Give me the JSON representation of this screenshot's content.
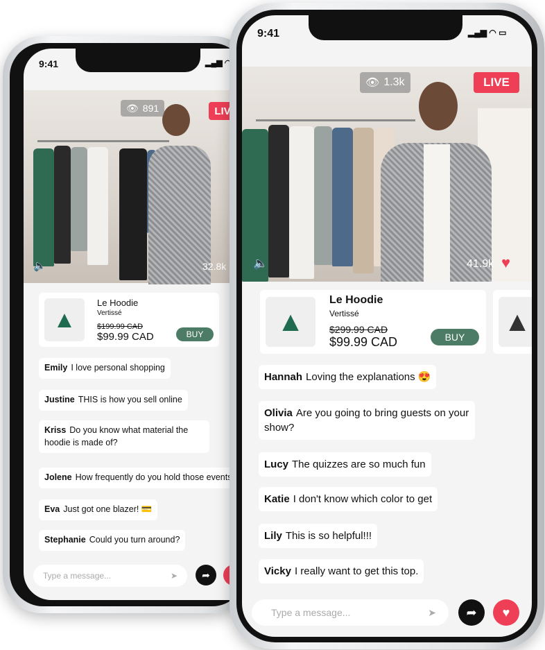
{
  "left_phone": {
    "time": "9:41",
    "viewers": "891",
    "live": "LIVE",
    "likes": "32.8k",
    "product": {
      "name": "Le Hoodie",
      "brand": "Vertissé",
      "old_price": "$199.99 CAD",
      "price": "$99.99 CAD",
      "buy": "BUY"
    },
    "chat": [
      {
        "user": "Emily",
        "text": "I love personal shopping"
      },
      {
        "user": "Justine",
        "text": "THIS is how you sell online"
      },
      {
        "user": "Kriss",
        "text": "Do you know what material the hoodie is made of?"
      },
      {
        "user": "Jolene",
        "text": "How frequently do you hold those events?"
      },
      {
        "user": "Eva",
        "text": "Just got one blazer! 💳"
      },
      {
        "user": "Stephanie",
        "text": "Could you turn around?"
      }
    ],
    "input_placeholder": "Type a message..."
  },
  "right_phone": {
    "time": "9:41",
    "viewers": "1.3k",
    "live": "LIVE",
    "likes": "41.9k",
    "product": {
      "name": "Le Hoodie",
      "brand": "Vertissé",
      "old_price": "$299.99 CAD",
      "price": "$99.99 CAD",
      "buy": "BUY"
    },
    "chat": [
      {
        "user": "Hannah",
        "text": "Loving the explanations 😍"
      },
      {
        "user": "Olivia",
        "text": "Are you going to bring guests on your show?"
      },
      {
        "user": "Lucy",
        "text": "The quizzes are so much fun"
      },
      {
        "user": "Katie",
        "text": "I don't know which color to get"
      },
      {
        "user": "Lily",
        "text": "This is so helpful!!!"
      },
      {
        "user": "Vicky",
        "text": "I really want to get this top."
      }
    ],
    "input_placeholder": "Type a message..."
  },
  "colors": {
    "live": "#ef3f56",
    "buy": "#4d7c66",
    "heart": "#ef3f56",
    "hoodie": "#1f6b4f"
  }
}
